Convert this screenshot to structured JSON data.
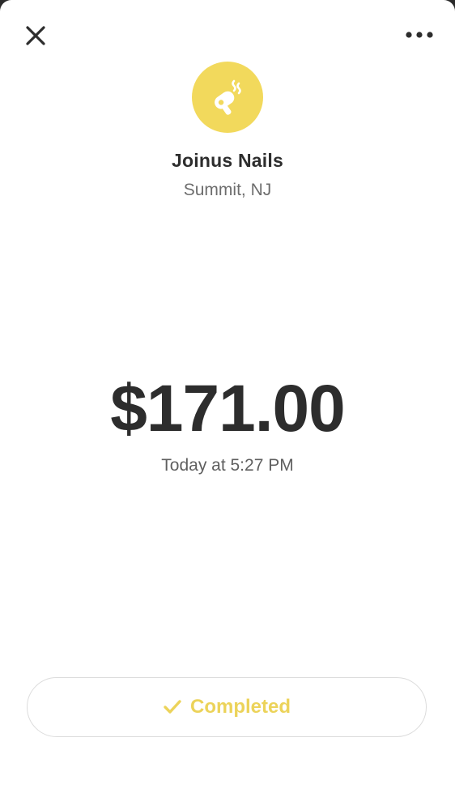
{
  "header": {
    "close_icon": "close-icon",
    "more_icon": "more-options-icon"
  },
  "merchant": {
    "logo_icon": "hair-dryer-icon",
    "logo_color": "#f2d95c",
    "name": "Joinus Nails",
    "location": "Summit, NJ"
  },
  "transaction": {
    "amount": "$171.00",
    "timestamp": "Today at 5:27 PM"
  },
  "status": {
    "icon": "checkmark-icon",
    "label": "Completed",
    "color": "#ecd35a"
  }
}
